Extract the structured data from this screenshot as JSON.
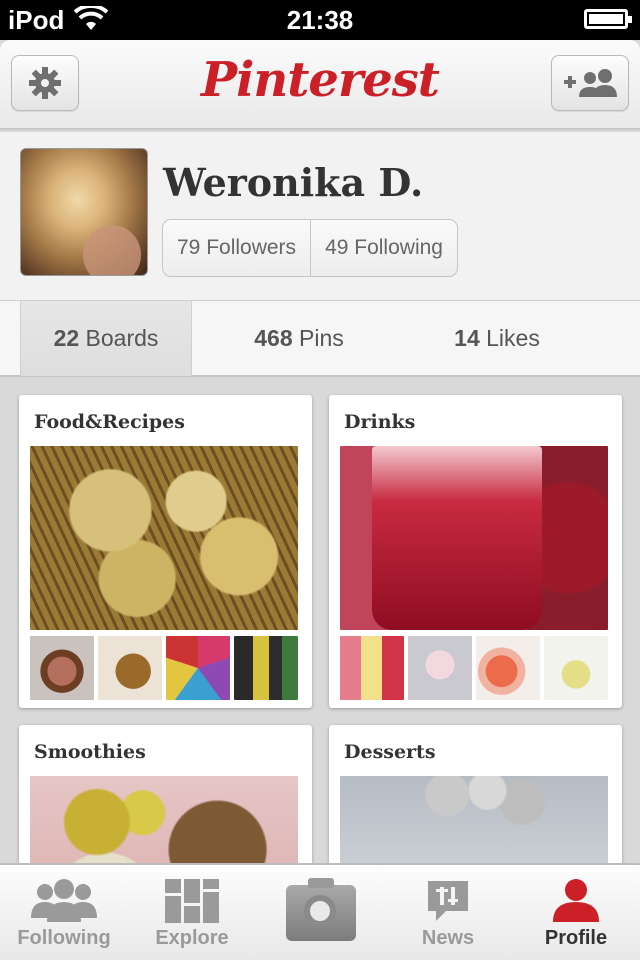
{
  "status_bar": {
    "carrier": "iPod",
    "time": "21:38"
  },
  "nav": {
    "logo": "Pinterest",
    "settings_icon": "gear-icon",
    "add_friends_icon": "add-people-icon"
  },
  "profile": {
    "name": "Weronika D.",
    "followers": "79 Followers",
    "following": "49 Following"
  },
  "tabs": [
    {
      "count": "22",
      "label": "Boards",
      "active": true
    },
    {
      "count": "468",
      "label": "Pins",
      "active": false
    },
    {
      "count": "14",
      "label": "Likes",
      "active": false
    }
  ],
  "boards": [
    {
      "title": "Food&Recipes"
    },
    {
      "title": "Drinks"
    },
    {
      "title": "Smoothies"
    },
    {
      "title": "Desserts"
    }
  ],
  "tabbar": [
    {
      "label": "Following",
      "icon": "people-icon"
    },
    {
      "label": "Explore",
      "icon": "grid-icon"
    },
    {
      "label": "",
      "icon": "camera-icon"
    },
    {
      "label": "News",
      "icon": "news-icon"
    },
    {
      "label": "Profile",
      "icon": "person-icon",
      "active": true
    }
  ],
  "colors": {
    "brand_red": "#cb2027"
  }
}
